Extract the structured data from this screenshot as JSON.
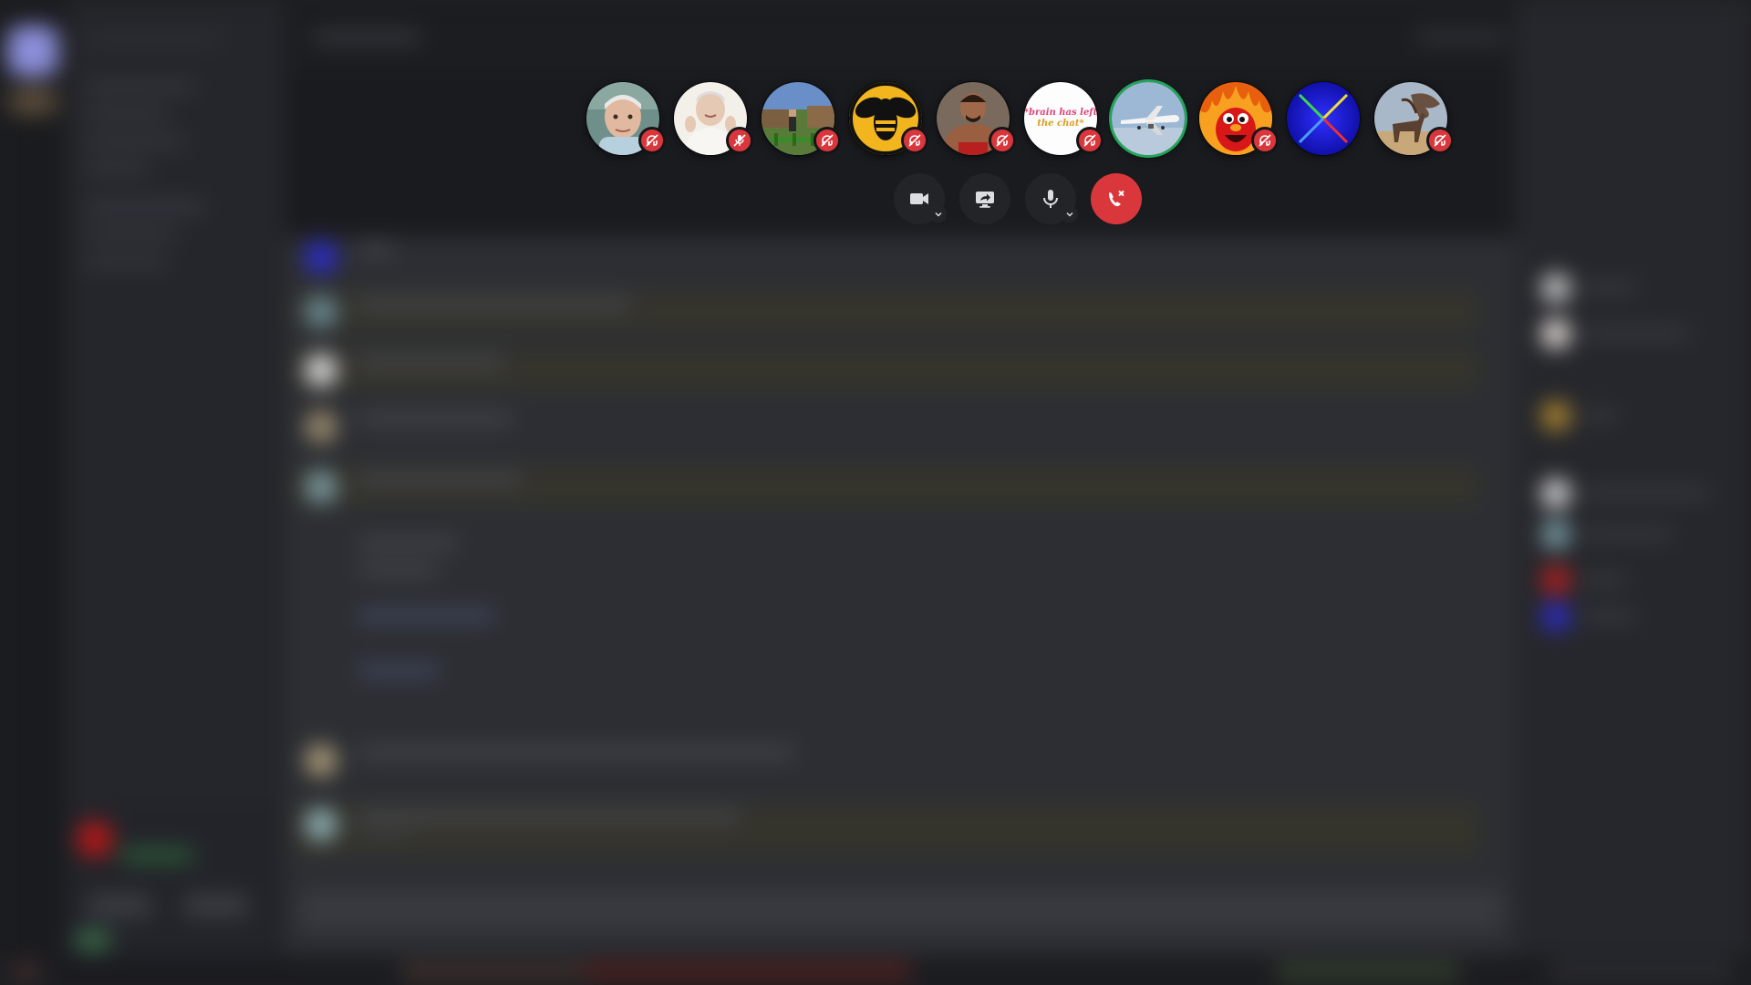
{
  "app": {
    "theme_colors": {
      "danger": "#da373c",
      "speaking_ring": "#23a559",
      "control_bg": "#232428",
      "icon": "#dbdee1"
    }
  },
  "call": {
    "participants": [
      {
        "avatar": "old-man-photo",
        "status": "deafened",
        "status_icon": "headphones-off-icon",
        "speaking": false
      },
      {
        "avatar": "old-woman-photo",
        "status": "muted",
        "status_icon": "mic-off-icon",
        "speaking": false
      },
      {
        "avatar": "minecraft-scene",
        "status": "deafened",
        "status_icon": "headphones-off-icon",
        "speaking": false
      },
      {
        "avatar": "bee-logo",
        "status": "deafened",
        "status_icon": "headphones-off-icon",
        "speaking": false
      },
      {
        "avatar": "muscular-man-photo",
        "status": "deafened",
        "status_icon": "headphones-off-icon",
        "speaking": false
      },
      {
        "avatar": "brain-has-left-text",
        "avatar_text_line1": "*brain has left",
        "avatar_text_line2": "the chat*",
        "status": "deafened",
        "status_icon": "headphones-off-icon",
        "speaking": false
      },
      {
        "avatar": "airplane-photo",
        "status": "none",
        "speaking": true
      },
      {
        "avatar": "burning-elmo",
        "status": "deafened",
        "status_icon": "headphones-off-icon",
        "speaking": false
      },
      {
        "avatar": "blue-x-logo",
        "status": "none",
        "speaking": false
      },
      {
        "avatar": "horse-tree-photo",
        "status": "deafened",
        "status_icon": "headphones-off-icon",
        "speaking": false
      }
    ],
    "controls": [
      {
        "id": "camera",
        "icon": "video-camera-icon",
        "has_dropdown": true
      },
      {
        "id": "screen-share",
        "icon": "screen-share-icon",
        "has_dropdown": false
      },
      {
        "id": "microphone",
        "icon": "microphone-icon",
        "has_dropdown": true
      },
      {
        "id": "disconnect",
        "icon": "phone-hangup-icon",
        "has_dropdown": false
      }
    ]
  }
}
